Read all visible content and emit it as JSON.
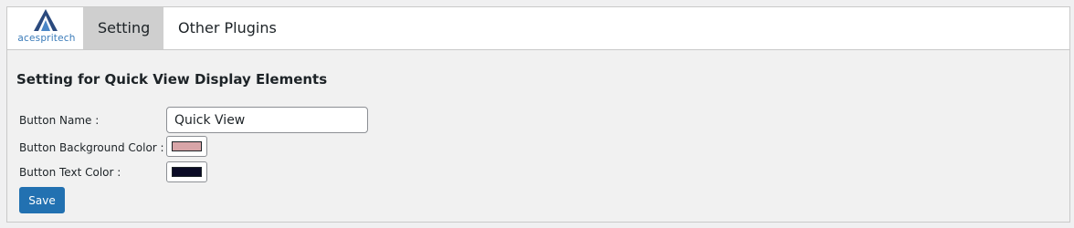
{
  "brand": {
    "name": "acespritech",
    "logo_icon": "mountain-a-logo-icon",
    "colors": {
      "primary": "#2b4a7e",
      "accent": "#3a7bb9"
    }
  },
  "tabs": [
    {
      "label": "Setting",
      "active": true
    },
    {
      "label": "Other Plugins",
      "active": false
    }
  ],
  "section": {
    "title": "Setting for Quick View Display Elements"
  },
  "fields": {
    "button_name": {
      "label": "Button Name :",
      "value": "Quick View"
    },
    "bg_color": {
      "label": "Button Background Color :",
      "value": "#d8a5a8"
    },
    "text_color": {
      "label": "Button Text Color :",
      "value": "#0b0b26"
    }
  },
  "actions": {
    "save_label": "Save",
    "save_color": "#2271b1"
  }
}
